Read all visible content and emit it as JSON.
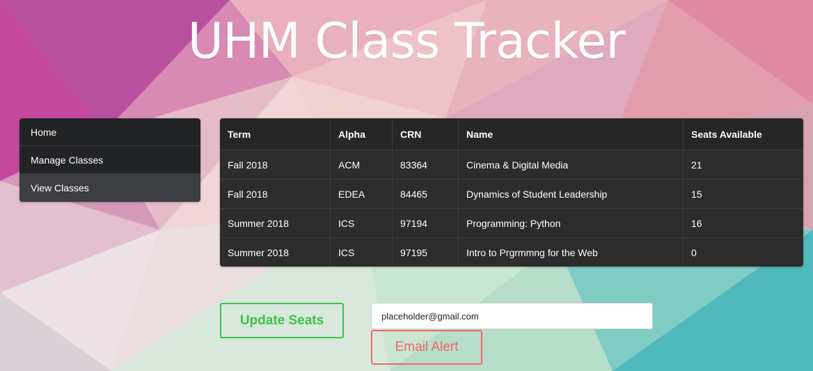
{
  "app": {
    "title": "UHM Class Tracker"
  },
  "nav": {
    "items": [
      {
        "label": "Home"
      },
      {
        "label": "Manage Classes"
      },
      {
        "label": "View Classes"
      }
    ],
    "active": "View Classes"
  },
  "table": {
    "headers": [
      "Term",
      "Alpha",
      "CRN",
      "Name",
      "Seats Available"
    ],
    "rows": [
      [
        "Fall 2018",
        "ACM",
        "83364",
        "Cinema & Digital Media",
        "21"
      ],
      [
        "Fall 2018",
        "EDEA",
        "84465",
        "Dynamics of Student Leadership",
        "15"
      ],
      [
        "Summer 2018",
        "ICS",
        "97194",
        "Programming: Python",
        "16"
      ],
      [
        "Summer 2018",
        "ICS",
        "97195",
        "Intro to Prgrmmng for the Web",
        "0"
      ]
    ]
  },
  "actions": {
    "update_label": "Update Seats",
    "email_value": "placeholder@gmail.com",
    "email_alert_label": "Email Alert"
  },
  "colors": {
    "update_accent": "#3ec04b",
    "alert_accent": "#f0685e",
    "panel_dark": "#2c2c2c"
  }
}
